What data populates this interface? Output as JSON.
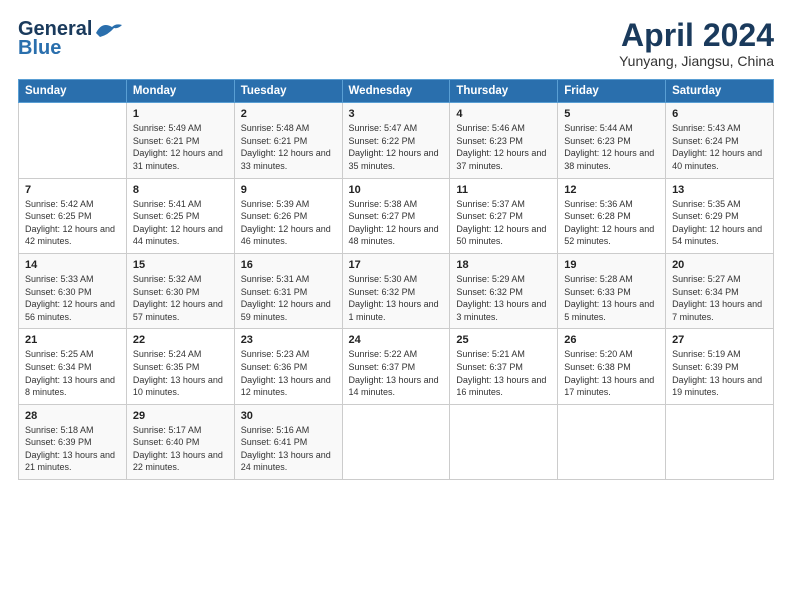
{
  "logo": {
    "line1": "General",
    "line2": "Blue"
  },
  "title": "April 2024",
  "subtitle": "Yunyang, Jiangsu, China",
  "header_days": [
    "Sunday",
    "Monday",
    "Tuesday",
    "Wednesday",
    "Thursday",
    "Friday",
    "Saturday"
  ],
  "weeks": [
    [
      {
        "num": "",
        "sunrise": "",
        "sunset": "",
        "daylight": ""
      },
      {
        "num": "1",
        "sunrise": "Sunrise: 5:49 AM",
        "sunset": "Sunset: 6:21 PM",
        "daylight": "Daylight: 12 hours and 31 minutes."
      },
      {
        "num": "2",
        "sunrise": "Sunrise: 5:48 AM",
        "sunset": "Sunset: 6:21 PM",
        "daylight": "Daylight: 12 hours and 33 minutes."
      },
      {
        "num": "3",
        "sunrise": "Sunrise: 5:47 AM",
        "sunset": "Sunset: 6:22 PM",
        "daylight": "Daylight: 12 hours and 35 minutes."
      },
      {
        "num": "4",
        "sunrise": "Sunrise: 5:46 AM",
        "sunset": "Sunset: 6:23 PM",
        "daylight": "Daylight: 12 hours and 37 minutes."
      },
      {
        "num": "5",
        "sunrise": "Sunrise: 5:44 AM",
        "sunset": "Sunset: 6:23 PM",
        "daylight": "Daylight: 12 hours and 38 minutes."
      },
      {
        "num": "6",
        "sunrise": "Sunrise: 5:43 AM",
        "sunset": "Sunset: 6:24 PM",
        "daylight": "Daylight: 12 hours and 40 minutes."
      }
    ],
    [
      {
        "num": "7",
        "sunrise": "Sunrise: 5:42 AM",
        "sunset": "Sunset: 6:25 PM",
        "daylight": "Daylight: 12 hours and 42 minutes."
      },
      {
        "num": "8",
        "sunrise": "Sunrise: 5:41 AM",
        "sunset": "Sunset: 6:25 PM",
        "daylight": "Daylight: 12 hours and 44 minutes."
      },
      {
        "num": "9",
        "sunrise": "Sunrise: 5:39 AM",
        "sunset": "Sunset: 6:26 PM",
        "daylight": "Daylight: 12 hours and 46 minutes."
      },
      {
        "num": "10",
        "sunrise": "Sunrise: 5:38 AM",
        "sunset": "Sunset: 6:27 PM",
        "daylight": "Daylight: 12 hours and 48 minutes."
      },
      {
        "num": "11",
        "sunrise": "Sunrise: 5:37 AM",
        "sunset": "Sunset: 6:27 PM",
        "daylight": "Daylight: 12 hours and 50 minutes."
      },
      {
        "num": "12",
        "sunrise": "Sunrise: 5:36 AM",
        "sunset": "Sunset: 6:28 PM",
        "daylight": "Daylight: 12 hours and 52 minutes."
      },
      {
        "num": "13",
        "sunrise": "Sunrise: 5:35 AM",
        "sunset": "Sunset: 6:29 PM",
        "daylight": "Daylight: 12 hours and 54 minutes."
      }
    ],
    [
      {
        "num": "14",
        "sunrise": "Sunrise: 5:33 AM",
        "sunset": "Sunset: 6:30 PM",
        "daylight": "Daylight: 12 hours and 56 minutes."
      },
      {
        "num": "15",
        "sunrise": "Sunrise: 5:32 AM",
        "sunset": "Sunset: 6:30 PM",
        "daylight": "Daylight: 12 hours and 57 minutes."
      },
      {
        "num": "16",
        "sunrise": "Sunrise: 5:31 AM",
        "sunset": "Sunset: 6:31 PM",
        "daylight": "Daylight: 12 hours and 59 minutes."
      },
      {
        "num": "17",
        "sunrise": "Sunrise: 5:30 AM",
        "sunset": "Sunset: 6:32 PM",
        "daylight": "Daylight: 13 hours and 1 minute."
      },
      {
        "num": "18",
        "sunrise": "Sunrise: 5:29 AM",
        "sunset": "Sunset: 6:32 PM",
        "daylight": "Daylight: 13 hours and 3 minutes."
      },
      {
        "num": "19",
        "sunrise": "Sunrise: 5:28 AM",
        "sunset": "Sunset: 6:33 PM",
        "daylight": "Daylight: 13 hours and 5 minutes."
      },
      {
        "num": "20",
        "sunrise": "Sunrise: 5:27 AM",
        "sunset": "Sunset: 6:34 PM",
        "daylight": "Daylight: 13 hours and 7 minutes."
      }
    ],
    [
      {
        "num": "21",
        "sunrise": "Sunrise: 5:25 AM",
        "sunset": "Sunset: 6:34 PM",
        "daylight": "Daylight: 13 hours and 8 minutes."
      },
      {
        "num": "22",
        "sunrise": "Sunrise: 5:24 AM",
        "sunset": "Sunset: 6:35 PM",
        "daylight": "Daylight: 13 hours and 10 minutes."
      },
      {
        "num": "23",
        "sunrise": "Sunrise: 5:23 AM",
        "sunset": "Sunset: 6:36 PM",
        "daylight": "Daylight: 13 hours and 12 minutes."
      },
      {
        "num": "24",
        "sunrise": "Sunrise: 5:22 AM",
        "sunset": "Sunset: 6:37 PM",
        "daylight": "Daylight: 13 hours and 14 minutes."
      },
      {
        "num": "25",
        "sunrise": "Sunrise: 5:21 AM",
        "sunset": "Sunset: 6:37 PM",
        "daylight": "Daylight: 13 hours and 16 minutes."
      },
      {
        "num": "26",
        "sunrise": "Sunrise: 5:20 AM",
        "sunset": "Sunset: 6:38 PM",
        "daylight": "Daylight: 13 hours and 17 minutes."
      },
      {
        "num": "27",
        "sunrise": "Sunrise: 5:19 AM",
        "sunset": "Sunset: 6:39 PM",
        "daylight": "Daylight: 13 hours and 19 minutes."
      }
    ],
    [
      {
        "num": "28",
        "sunrise": "Sunrise: 5:18 AM",
        "sunset": "Sunset: 6:39 PM",
        "daylight": "Daylight: 13 hours and 21 minutes."
      },
      {
        "num": "29",
        "sunrise": "Sunrise: 5:17 AM",
        "sunset": "Sunset: 6:40 PM",
        "daylight": "Daylight: 13 hours and 22 minutes."
      },
      {
        "num": "30",
        "sunrise": "Sunrise: 5:16 AM",
        "sunset": "Sunset: 6:41 PM",
        "daylight": "Daylight: 13 hours and 24 minutes."
      },
      {
        "num": "",
        "sunrise": "",
        "sunset": "",
        "daylight": ""
      },
      {
        "num": "",
        "sunrise": "",
        "sunset": "",
        "daylight": ""
      },
      {
        "num": "",
        "sunrise": "",
        "sunset": "",
        "daylight": ""
      },
      {
        "num": "",
        "sunrise": "",
        "sunset": "",
        "daylight": ""
      }
    ]
  ]
}
